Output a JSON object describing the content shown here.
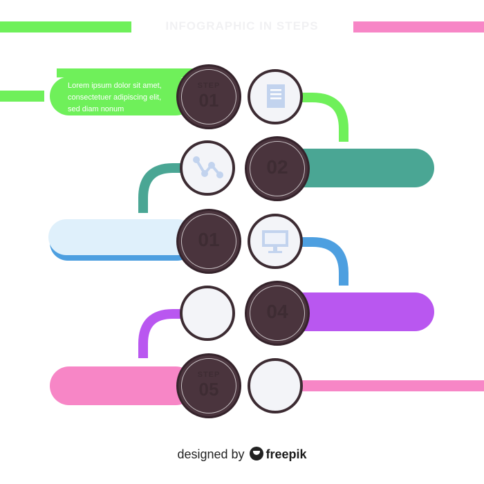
{
  "title": "INFOGRAPHIC IN STEPS",
  "steps": [
    {
      "word": "STEP",
      "number": "01",
      "text_lines": [
        "Lorem ipsum dolor sit amet,",
        "consectetuer adipiscing elit,",
        "sed diam nonum"
      ],
      "color": "#6ff05a",
      "icon": "document-icon"
    },
    {
      "word": "",
      "number": "02",
      "text_lines": [],
      "color": "#4aa694",
      "icon": "line-chart-icon"
    },
    {
      "word": "",
      "number": "01",
      "text_lines": [],
      "color": "#dff0fb",
      "accent": "#4d9fe0",
      "icon": "monitor-icon"
    },
    {
      "word": "",
      "number": "04",
      "text_lines": [],
      "color": "#b957f0",
      "icon": "blank-icon"
    },
    {
      "word": "STEP",
      "number": "05",
      "text_lines": [],
      "color": "#f786c6",
      "icon": "blank-icon"
    }
  ],
  "credit": {
    "prefix": "designed by",
    "brand": "freepik"
  }
}
